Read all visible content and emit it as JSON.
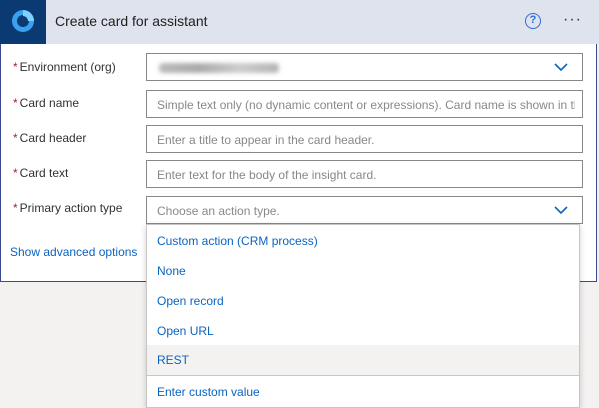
{
  "header": {
    "title": "Create card for assistant",
    "help_icon": "?",
    "more_icon": "···"
  },
  "fields": {
    "environment": {
      "label": "Environment (org)",
      "required": "*"
    },
    "card_name": {
      "label": "Card name",
      "required": "*",
      "placeholder": "Simple text only (no dynamic content or expressions). Card name is shown in th"
    },
    "card_header": {
      "label": "Card header",
      "required": "*",
      "placeholder": "Enter a title to appear in the card header."
    },
    "card_text": {
      "label": "Card text",
      "required": "*",
      "placeholder": "Enter text for the body of the insight card."
    },
    "primary_action": {
      "label": "Primary action type",
      "required": "*",
      "placeholder": "Choose an action type."
    }
  },
  "advanced_link": "Show advanced options",
  "dropdown": {
    "options": [
      "Custom action (CRM process)",
      "None",
      "Open record",
      "Open URL",
      "REST"
    ],
    "custom_value": "Enter custom value"
  },
  "colors": {
    "accent": "#0b63c2",
    "header_bg": "#dfe3ed",
    "logo_bg": "#0b3a73",
    "required": "#a4262c"
  }
}
